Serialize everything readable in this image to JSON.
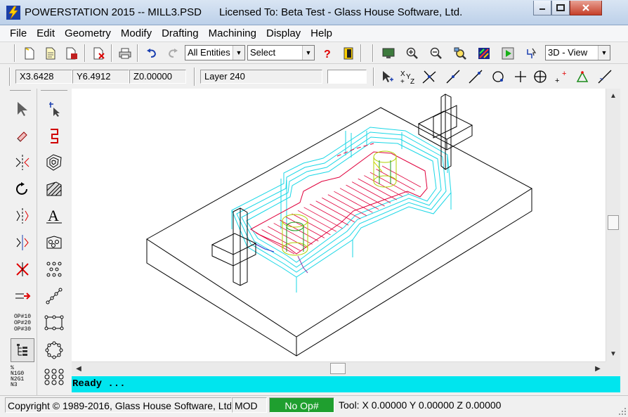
{
  "window": {
    "title": "POWERSTATION 2015 -- MILL3.PSD      Licensed To: Beta Test - Glass House Software, Ltd."
  },
  "menu": [
    {
      "label": "File"
    },
    {
      "label": "Edit"
    },
    {
      "label": "Geometry"
    },
    {
      "label": "Modify"
    },
    {
      "label": "Drafting"
    },
    {
      "label": "Machining"
    },
    {
      "label": "Display"
    },
    {
      "label": "Help"
    }
  ],
  "toolbar": {
    "entity_filter": "All Entities",
    "select_mode": "Select",
    "view_mode": "3D - View",
    "icons": [
      "new-file-icon",
      "open-file-icon",
      "save-file-icon",
      "close-file-icon",
      "print-icon",
      "undo-icon",
      "redo-icon",
      "help-icon",
      "exit-icon",
      "monitor-icon",
      "zoom-in-icon",
      "zoom-out-icon",
      "zoom-window-icon",
      "color-palette-icon",
      "run-icon",
      "pointer-path-icon"
    ]
  },
  "coords": {
    "x": "X3.6428",
    "y": "Y6.4912",
    "z": "Z0.00000",
    "layer": "Layer 240",
    "extra": ""
  },
  "snap_icons": [
    "cursor-snap-icon",
    "xyz-icon",
    "intersection-icon",
    "line-point-icon",
    "line-icon",
    "circle-icon",
    "plus-icon",
    "center-point-icon",
    "point-icon",
    "triangle-icon",
    "angle-line-icon"
  ],
  "palette": {
    "left": [
      "select-arrow-icon",
      "erase-icon",
      "mirror-icon",
      "rotate-icon",
      "offset-icon",
      "copy-icon",
      "trim-icon",
      "extend-icon",
      "op-list-icon",
      "tree-view-icon",
      "nc-code-icon"
    ],
    "right": [
      "select-multi-icon",
      "chain-icon",
      "pocket-icon",
      "hatch-icon",
      "text-icon",
      "dimension-icon",
      "points-pattern-icon",
      "line-points-icon",
      "rect-points-icon",
      "circle-points-icon",
      "grid-points-icon"
    ],
    "op_labels": [
      "OP#10",
      "OP#20",
      "OP#30"
    ],
    "nc_labels": [
      "%",
      "N1G0",
      "N2G1",
      "N3"
    ]
  },
  "prompt": "Ready ...",
  "status": {
    "copyright": "Copyright © 1989-2016, Glass House Software, Ltd.",
    "mode": "MOD",
    "op": "No Op#",
    "tool": "Tool: X 0.00000 Y 0.00000 Z 0.00000"
  },
  "colors": {
    "status_cyan": "#00e5ee",
    "op_green": "#1f9f2f",
    "toolpath_cyan": "#1ad7e6",
    "toolpath_red": "#e0003c",
    "toolpath_yellow": "#d4d400"
  }
}
